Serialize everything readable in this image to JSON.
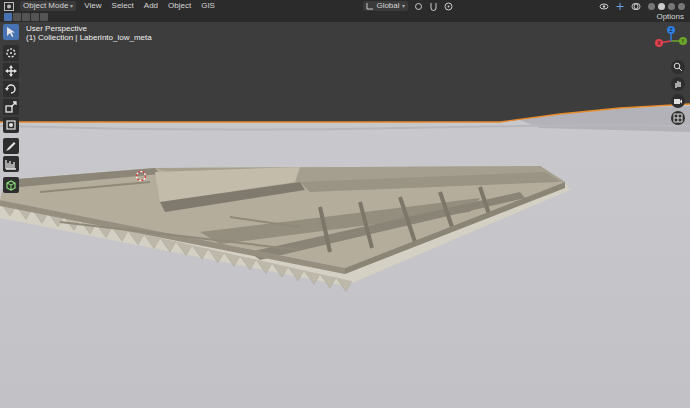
{
  "header": {
    "mode": "Object Mode",
    "menus": [
      "View",
      "Select",
      "Add",
      "Object",
      "GIS"
    ],
    "transform_orientation": "Global",
    "options": "Options"
  },
  "select_modes": [
    {
      "selected": true
    },
    {
      "selected": false
    },
    {
      "selected": false
    },
    {
      "selected": false
    },
    {
      "selected": false
    }
  ],
  "viewport": {
    "view": "User Perspective",
    "collection": "(1) Collection | Laberinto_low_meta"
  },
  "toolbar": {
    "tools": [
      {
        "kind": "select",
        "selected": true
      },
      {
        "kind": "cursor",
        "selected": false
      },
      {
        "kind": "move",
        "selected": false
      },
      {
        "kind": "rotate",
        "selected": false
      },
      {
        "kind": "scale",
        "selected": false
      },
      {
        "kind": "transform",
        "selected": false
      },
      {
        "kind": "annotate",
        "selected": false
      },
      {
        "kind": "measure",
        "selected": false
      },
      {
        "kind": "add",
        "selected": false
      }
    ]
  },
  "gizmo": {
    "axes": [
      {
        "label": "X",
        "color": "#e2404f"
      },
      {
        "label": "Y",
        "color": "#6ea82a"
      },
      {
        "label": "Z",
        "color": "#2e7fe0"
      }
    ]
  }
}
